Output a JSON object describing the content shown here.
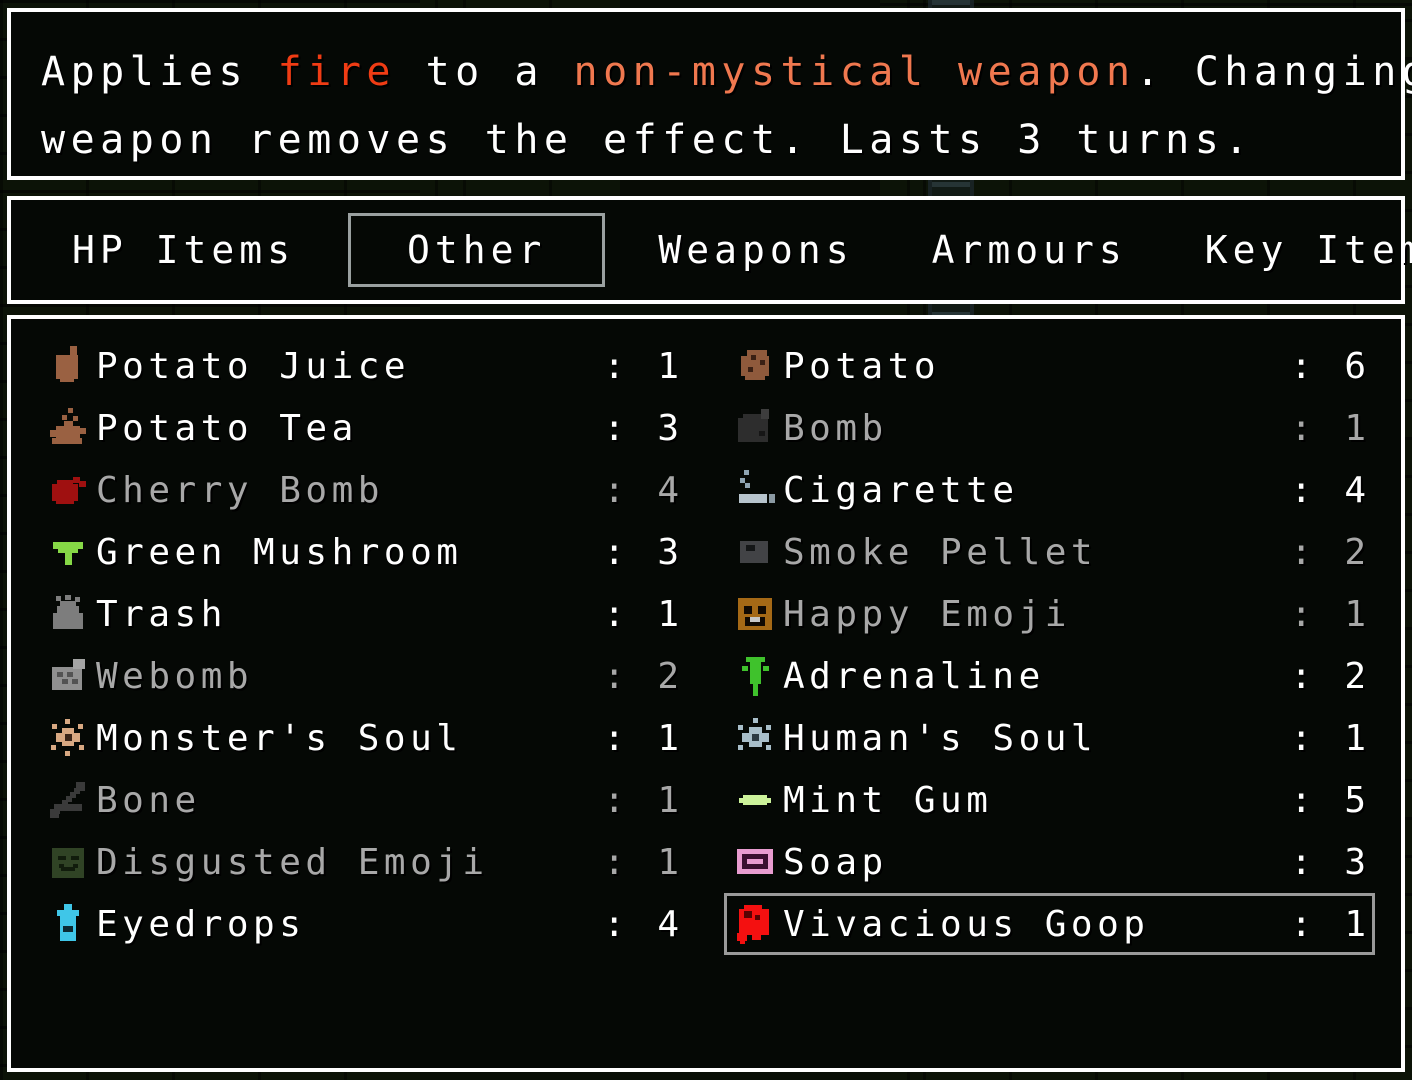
{
  "description": {
    "lines": [
      [
        {
          "text": "Applies ",
          "style": "white"
        },
        {
          "text": "fire",
          "style": "fire"
        },
        {
          "text": " to a ",
          "style": "white"
        },
        {
          "text": "non-mystical weapon",
          "style": "orange"
        },
        {
          "text": ". Changing your",
          "style": "white"
        }
      ],
      [
        {
          "text": "weapon removes the effect. Lasts 3 turns.",
          "style": "white"
        }
      ]
    ]
  },
  "tabs": [
    {
      "label": "HP Items",
      "selected": false
    },
    {
      "label": "Other",
      "selected": true
    },
    {
      "label": "Weapons",
      "selected": false
    },
    {
      "label": "Armours",
      "selected": false
    },
    {
      "label": "Key Items",
      "selected": false
    }
  ],
  "items": {
    "separator": ":",
    "left": [
      {
        "name": "Potato Juice",
        "qty": "1",
        "icon": "potato-juice-icon",
        "dimmed": false,
        "selected": false
      },
      {
        "name": "Potato Tea",
        "qty": "3",
        "icon": "potato-tea-icon",
        "dimmed": false,
        "selected": false
      },
      {
        "name": "Cherry Bomb",
        "qty": "4",
        "icon": "cherry-bomb-icon",
        "dimmed": true,
        "selected": false
      },
      {
        "name": "Green Mushroom",
        "qty": "3",
        "icon": "green-mushroom-icon",
        "dimmed": false,
        "selected": false
      },
      {
        "name": "Trash",
        "qty": "1",
        "icon": "trash-icon",
        "dimmed": false,
        "selected": false
      },
      {
        "name": "Webomb",
        "qty": "2",
        "icon": "webomb-icon",
        "dimmed": true,
        "selected": false
      },
      {
        "name": "Monster's Soul",
        "qty": "1",
        "icon": "monsters-soul-icon",
        "dimmed": false,
        "selected": false
      },
      {
        "name": "Bone",
        "qty": "1",
        "icon": "bone-icon",
        "dimmed": true,
        "selected": false
      },
      {
        "name": "Disgusted Emoji",
        "qty": "1",
        "icon": "disgusted-emoji-icon",
        "dimmed": true,
        "selected": false
      },
      {
        "name": "Eyedrops",
        "qty": "4",
        "icon": "eyedrops-icon",
        "dimmed": false,
        "selected": false
      }
    ],
    "right": [
      {
        "name": "Potato",
        "qty": "6",
        "icon": "potato-icon",
        "dimmed": false,
        "selected": false
      },
      {
        "name": "Bomb",
        "qty": "1",
        "icon": "bomb-icon",
        "dimmed": true,
        "selected": false
      },
      {
        "name": "Cigarette",
        "qty": "4",
        "icon": "cigarette-icon",
        "dimmed": false,
        "selected": false
      },
      {
        "name": "Smoke Pellet",
        "qty": "2",
        "icon": "smoke-pellet-icon",
        "dimmed": true,
        "selected": false
      },
      {
        "name": "Happy Emoji",
        "qty": "1",
        "icon": "happy-emoji-icon",
        "dimmed": true,
        "selected": false
      },
      {
        "name": "Adrenaline",
        "qty": "2",
        "icon": "adrenaline-icon",
        "dimmed": false,
        "selected": false
      },
      {
        "name": "Human's Soul",
        "qty": "1",
        "icon": "humans-soul-icon",
        "dimmed": false,
        "selected": false
      },
      {
        "name": "Mint Gum",
        "qty": "5",
        "icon": "mint-gum-icon",
        "dimmed": false,
        "selected": false
      },
      {
        "name": "Soap",
        "qty": "3",
        "icon": "soap-icon",
        "dimmed": false,
        "selected": false
      },
      {
        "name": "Vivacious Goop",
        "qty": "1",
        "icon": "vivacious-goop-icon",
        "dimmed": false,
        "selected": true
      }
    ]
  },
  "colors": {
    "panel_border": "#ffffff",
    "panel_background": "#050805",
    "text": "#ffffff",
    "text_dimmed": "#a8a8a8",
    "highlight_fire": "#f03c14",
    "highlight_orange": "#f0784f",
    "selection_border": "#9a9a9a",
    "scene_background": "#0d1408"
  }
}
